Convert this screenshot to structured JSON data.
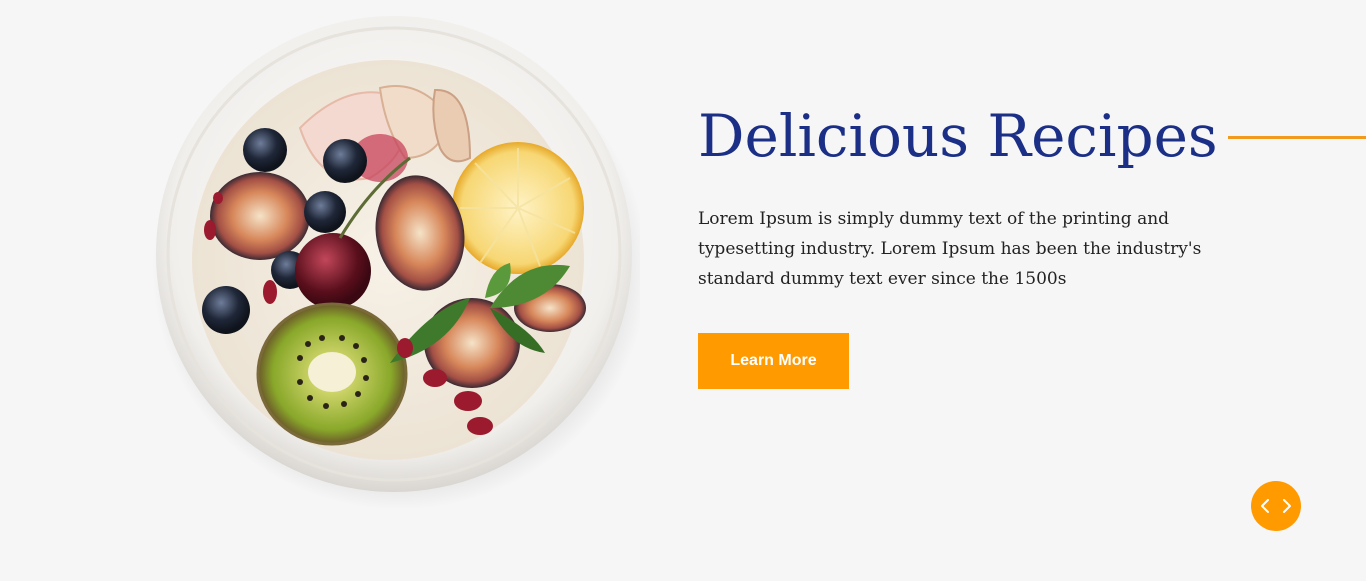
{
  "colors": {
    "background": "#f6f6f6",
    "title": "#1b2f86",
    "accent": "#ff9a00",
    "accent_line": "#f29a1d",
    "body_text": "#222222"
  },
  "hero": {
    "title": "Delicious Recipes",
    "description": "Lorem Ipsum is simply dummy text of the printing and typesetting industry. Lorem Ipsum has been the industry's standard dummy text ever since the 1500s",
    "cta_label": "Learn More"
  },
  "image": {
    "subject": "fruit-bowl"
  },
  "pager": {
    "prev_icon": "chevron-left-icon",
    "next_icon": "chevron-right-icon"
  }
}
